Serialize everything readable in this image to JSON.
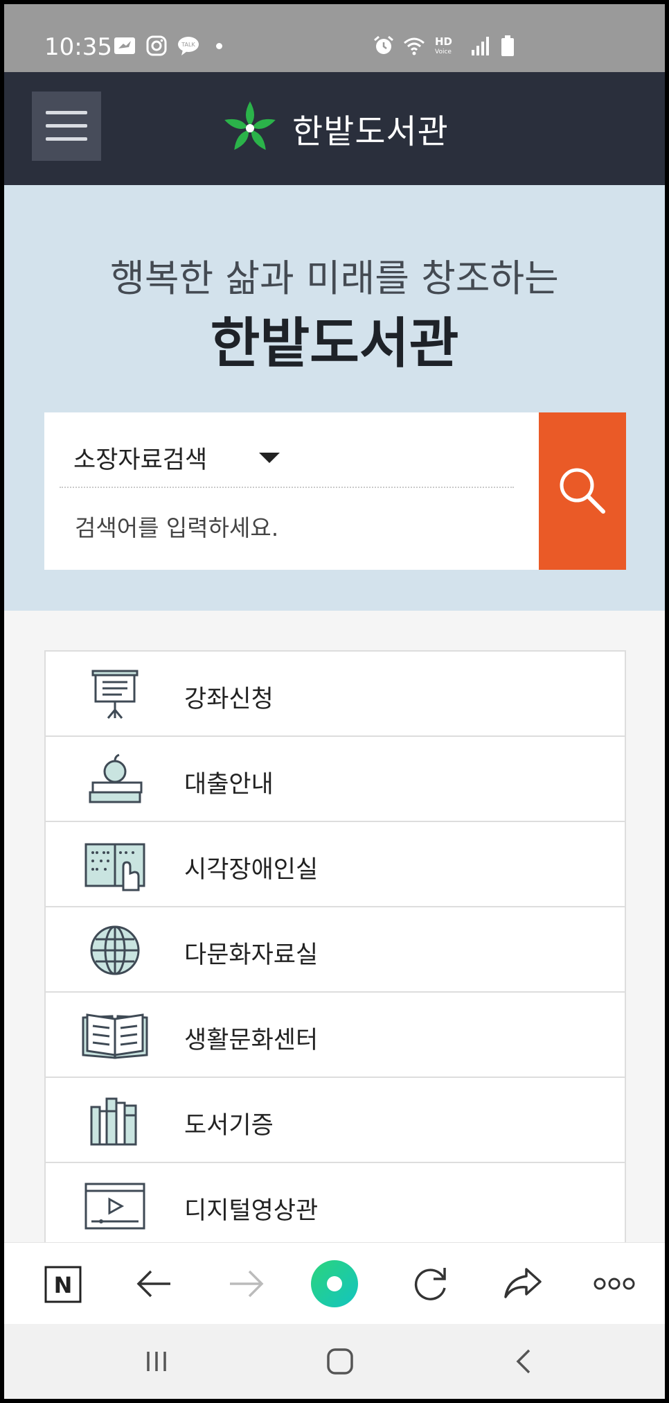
{
  "status_bar": {
    "time": "10:35",
    "left_icons": [
      "bird-notification-icon",
      "instagram-icon",
      "kakaotalk-icon",
      "dot-icon"
    ],
    "kakao_label": "TALK",
    "right_icons": [
      "alarm-icon",
      "wifi-icon",
      "hd-voice-icon",
      "signal-icon",
      "battery-icon"
    ],
    "hd_label": "HD",
    "voice_label": "Voice"
  },
  "header": {
    "menu_icon": "hamburger-icon",
    "logo_icon": "green-star-leaf-icon",
    "logo_text": "한밭도서관",
    "background": "#2a2f3c"
  },
  "hero": {
    "subtitle": "행복한 삶과 미래를 창조하는",
    "title": "한밭도서관",
    "background": "#d3e2ec"
  },
  "search": {
    "selected_option": "소장자료검색",
    "placeholder": "검색어를 입력하세요.",
    "button_icon": "search-icon",
    "button_color": "#ea5a27"
  },
  "menu": {
    "items": [
      {
        "label": "강좌신청",
        "icon": "presentation-board-icon"
      },
      {
        "label": "대출안내",
        "icon": "apple-on-books-icon"
      },
      {
        "label": "시각장애인실",
        "icon": "braille-book-icon"
      },
      {
        "label": "다문화자료실",
        "icon": "globe-icon"
      },
      {
        "label": "생활문화센터",
        "icon": "open-book-icon"
      },
      {
        "label": "도서기증",
        "icon": "books-on-shelf-icon"
      },
      {
        "label": "디지털영상관",
        "icon": "video-player-icon"
      }
    ]
  },
  "toolbar": {
    "naver_label": "N",
    "buttons": [
      "naver-home-icon",
      "back-arrow-icon",
      "forward-arrow-icon",
      "green-dot-icon",
      "refresh-icon",
      "share-icon",
      "more-icon"
    ]
  },
  "navbar": {
    "buttons": [
      "recent-apps-icon",
      "home-icon",
      "back-icon"
    ]
  }
}
